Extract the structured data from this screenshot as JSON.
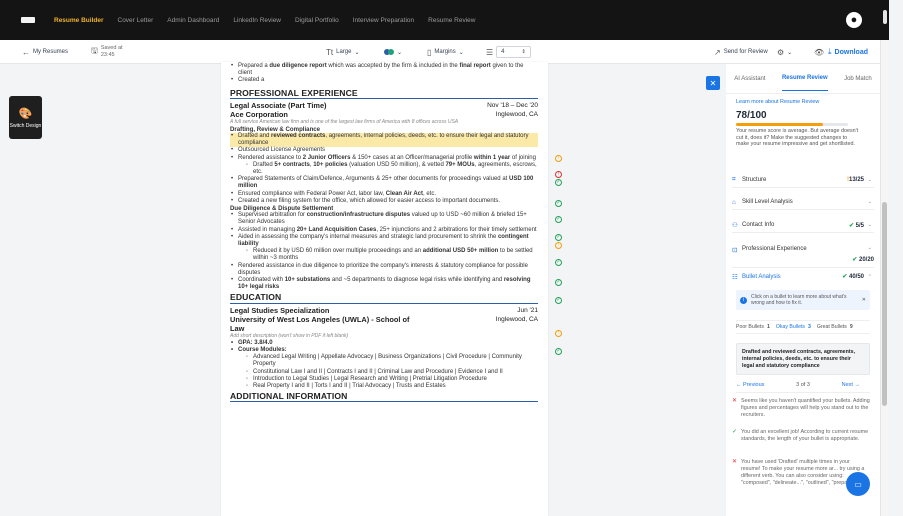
{
  "nav": {
    "items": [
      "Resume Builder",
      "Cover Letter",
      "Admin Dashboard",
      "LinkedIn Review",
      "Digital Portfolio",
      "Interview Preparation",
      "Resume Review"
    ],
    "active_index": 0
  },
  "toolbar": {
    "back_label": "My Resumes",
    "saved_label": "Saved at",
    "saved_time": "23:45",
    "size_label": "Large",
    "margins_label": "Margins",
    "spacing_value": "4",
    "send_review_label": "Send for Review",
    "download_label": "Download",
    "colors": [
      "#2d5fa8",
      "#1fa37a"
    ]
  },
  "left_rail": {
    "switch_design_label": "Switch Design"
  },
  "resume": {
    "top_bullets": [
      {
        "pre": "Prepared a ",
        "b1": "due diligence report",
        "mid": " which was accepted by the firm & included in the ",
        "b2": "final report",
        "post": " given to the client"
      },
      {
        "pre": "Created a",
        "b1": "",
        "mid": "",
        "b2": "",
        "post": ""
      }
    ],
    "exp_heading": "PROFESSIONAL EXPERIENCE",
    "job_title": "Legal Associate (Part Time)",
    "job_dates": "Nov '18 – Dec '20",
    "company": "Ace Corporation",
    "location": "Inglewood, CA",
    "company_desc": "A full service American law firm and is one of the largest law firms of America with 8 offices across USA",
    "sub1": "Drafting, Review & Compliance",
    "b_draft": {
      "pre": "Drafted and ",
      "bold": "reviewed contracts",
      "post": ", agreements, internal policies, deeds, etc. to ensure their legal and statutory compliance"
    },
    "b_outsourced": "Outsourced License Agreements",
    "b_rendered": {
      "pre": "Rendered assistance to ",
      "b1": "2 Junior Officers",
      "mid": " & 150+ cases at an Officer/managerial profile ",
      "b2": "within 1 year",
      "post": " of joining"
    },
    "b_sub_drafted": {
      "pre": "Drafted ",
      "b1": "5+ contracts",
      "mid": ", ",
      "b2": "10+ policies",
      "mid2": " (valuation USD 50 million), & vetted ",
      "b3": "79+ MOUs",
      "post": ", agreements, escrows, etc."
    },
    "b_prepared": {
      "pre": "Prepared Statements of Claim/Defence, Arguments & 25+ other documents for proceedings valued at ",
      "bold": "USD 100 million",
      "post": ""
    },
    "b_ensured": {
      "pre": "Ensured compliance with Federal Power Act, labor law, ",
      "bold": "Clean Air Act",
      "post": ", etc."
    },
    "b_created": "Created a new filing system for the office, which allowed for easier access to important documents.",
    "sub2": "Due Diligence & Dispute Settlement",
    "b_supervised": {
      "pre": "Supervised arbitration for ",
      "bold": "construction/infrastructure disputes",
      "post": " valued up to USD ~60 million & briefed 15+ Senior Advocates"
    },
    "b_assisted": {
      "pre": "Assisted in managing ",
      "bold": "20+ Land Acquisition Cases",
      "post": ", 25+ injunctions and 2 arbitrations for their timely settlement"
    },
    "b_aided": {
      "pre": "Aided in assessing the company's internal measures and strategic land procurement to shrink the ",
      "bold": "contingent liability",
      "post": ""
    },
    "b_sub_reduced": {
      "pre": "Reduced it by USD 60 million over multiple proceedings and an ",
      "bold": "additional USD 50+ million",
      "post": " to be settled within ~3 months"
    },
    "b_rendered2": "Rendered assistance in due diligence to prioritize the company's interests & statutory compliance for possible disputes",
    "b_coord": {
      "pre": "Coordinated with ",
      "b1": "10+ substations",
      "mid": " and ~5 departments to diagnose legal risks while identifying and ",
      "b2": "resolving 10+ legal risks",
      "post": ""
    },
    "edu_heading": "EDUCATION",
    "degree": "Legal Studies Specialization",
    "degree_date": "Jun '21",
    "school": "University of West Los Angeles (UWLA) - School of Law",
    "school_loc": "Inglewood, CA",
    "edu_note": "Add short description (won't show in PDF if left blank)",
    "gpa": "GPA: 3.8/4.0",
    "courses_label": "Course Modules:",
    "courses": [
      "Advanced Legal Writing | Appellate Advocacy | Business Organizations | Civil Procedure | Community Property",
      "Constitutional Law I and II | Contracts I and II | Criminal Law and Procedure | Evidence I and II",
      "Introduction to Legal Studies | Legal Research and Writing | Pretrial Litigation Procedure",
      "Real Property I and II | Torts I and II | Trial Advocacy | Trusts and Estates"
    ],
    "addl_heading": "ADDITIONAL INFORMATION"
  },
  "panel": {
    "tabs": [
      "AI Assistant",
      "Resume Review",
      "Job Match"
    ],
    "active_tab": 1,
    "learn_more": "Learn more about Resume Review",
    "score": "78/100",
    "score_desc": "Your resume score is average. But average doesn't cut it, does it? Make the suggested changes to make your resume impressive and get shortlisted.",
    "sections": [
      {
        "label": "Structure",
        "value": "13/25",
        "status": "warn"
      },
      {
        "label": "Skill Level Analysis",
        "value": "",
        "status": "none"
      },
      {
        "label": "Contact Info",
        "value": "5/5",
        "status": "ok"
      },
      {
        "label": "Professional Experience",
        "value": "20/20",
        "status": "ok"
      },
      {
        "label": "Bullet Analysis",
        "value": "40/50",
        "status": "ok"
      }
    ],
    "hint": "Click on a bullet to learn more about what's wrong and how to fix it.",
    "bullet_counts": {
      "poor_label": "Poor Bullets",
      "poor": "1",
      "okay_label": "Okay Bullets",
      "okay": "3",
      "great_label": "Great Bullets",
      "great": "9"
    },
    "bullet_quote": "Drafted and reviewed contracts, agreements, internal policies, deeds, etc. to ensure their legal and statutory compliance",
    "prev": "Previous",
    "page_of": "3 of 3",
    "next": "Next",
    "feedback": [
      {
        "type": "err",
        "text": "Seems like you haven't quantified your bullets. Adding figures and percentages will help you stand out to the recruiters."
      },
      {
        "type": "ok",
        "text": "You did an excellent job! According to current resume standards, the length of your bullet is appropriate."
      },
      {
        "type": "err",
        "text": "You have used 'Drafted' multiple times in your resume! To make your resume more ar... try using a different verb. You can also consider using: \"composed\", \"delineate...\", \"outlined\", \"prepared\"."
      }
    ]
  }
}
